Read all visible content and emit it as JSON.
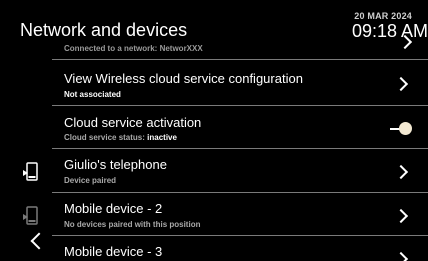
{
  "header": {
    "title": "Network and devices",
    "date": "20 MAR 2024",
    "time": "09:18 AM"
  },
  "partial_top": {
    "subtitle": "Connected to a network: NetworXXX"
  },
  "rows": [
    {
      "label": "View Wireless cloud service configuration",
      "subtitle": "Not associated",
      "control": "chevron"
    },
    {
      "label": "Cloud service activation",
      "subtitle_prefix": "Cloud service status: ",
      "subtitle_value": "inactive",
      "control": "toggle",
      "toggle_state": "off"
    },
    {
      "label": "Giulio's telephone",
      "subtitle": "Device paired",
      "control": "chevron",
      "icon": "phone-icon"
    },
    {
      "label": "Mobile device - 2",
      "subtitle": "No devices paired with this position",
      "control": "chevron",
      "icon": "phone-icon-dim"
    },
    {
      "label": "Mobile device - 3",
      "subtitle": "",
      "control": "chevron"
    }
  ],
  "icons": {
    "back": "back-arrow-icon",
    "phone": "mobile-phone-icon"
  },
  "colors": {
    "background": "#000000",
    "divider": "#7a7a7a",
    "subtitle": "#a9a9a9",
    "toggle_knob": "#f3e9d2"
  }
}
